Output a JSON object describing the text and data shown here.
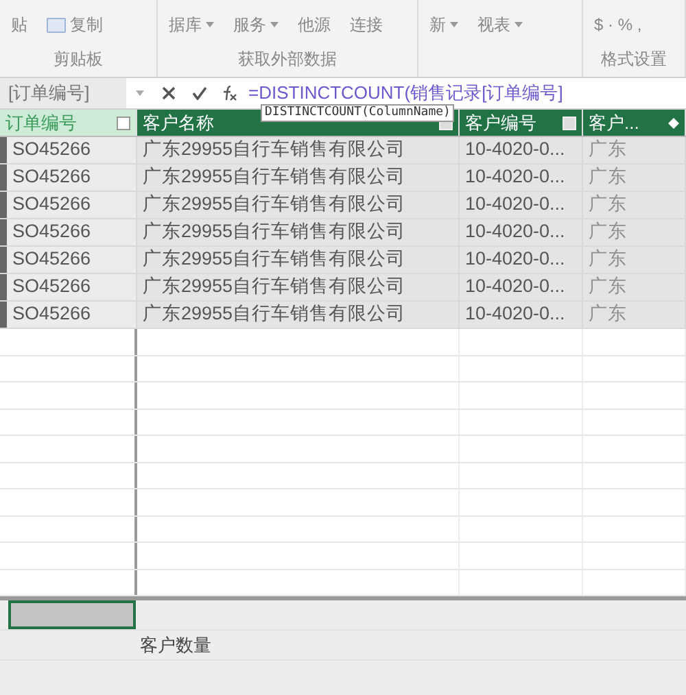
{
  "ribbon": {
    "groups": [
      {
        "label": "剪贴板",
        "items": [
          {
            "kind": "big",
            "text": "贴",
            "caret": false
          },
          {
            "kind": "small",
            "text": "复制",
            "caret": false
          }
        ]
      },
      {
        "label": "获取外部数据",
        "items": [
          {
            "kind": "big",
            "text": "据库",
            "caret": true
          },
          {
            "kind": "big",
            "text": "服务",
            "caret": true
          },
          {
            "kind": "big",
            "text": "他源",
            "caret": false
          },
          {
            "kind": "big",
            "text": "连接",
            "caret": false
          }
        ]
      },
      {
        "items": [
          {
            "kind": "big",
            "text": "新",
            "caret": true
          },
          {
            "kind": "big",
            "text": "视表",
            "caret": true
          }
        ]
      },
      {
        "label": "格式设置",
        "items": [
          {
            "kind": "plain",
            "text": "$ · % ,",
            "caret": false
          }
        ]
      }
    ]
  },
  "formula_bar": {
    "name_box": "[订单编号]",
    "formula": "=DISTINCTCOUNT(销售记录[订单编号]",
    "tooltip": "DISTINCTCOUNT(ColumnName)"
  },
  "table": {
    "columns": [
      {
        "label": "订单编号",
        "selected": true
      },
      {
        "label": "客户名称",
        "selected": false
      },
      {
        "label": "客户编号",
        "selected": false
      },
      {
        "label": "客户...",
        "selected": false
      }
    ],
    "rows": [
      [
        "SO45266",
        "广东29955自行车销售有限公司",
        "10-4020-0...",
        "广东"
      ],
      [
        "SO45266",
        "广东29955自行车销售有限公司",
        "10-4020-0...",
        "广东"
      ],
      [
        "SO45266",
        "广东29955自行车销售有限公司",
        "10-4020-0...",
        "广东"
      ],
      [
        "SO45266",
        "广东29955自行车销售有限公司",
        "10-4020-0...",
        "广东"
      ],
      [
        "SO45266",
        "广东29955自行车销售有限公司",
        "10-4020-0...",
        "广东"
      ],
      [
        "SO45266",
        "广东29955自行车销售有限公司",
        "10-4020-0...",
        "广东"
      ],
      [
        "SO45266",
        "广东29955自行车销售有限公司",
        "10-4020-0...",
        "广东"
      ]
    ]
  },
  "calc_area": {
    "measure_label": "客户数量"
  }
}
